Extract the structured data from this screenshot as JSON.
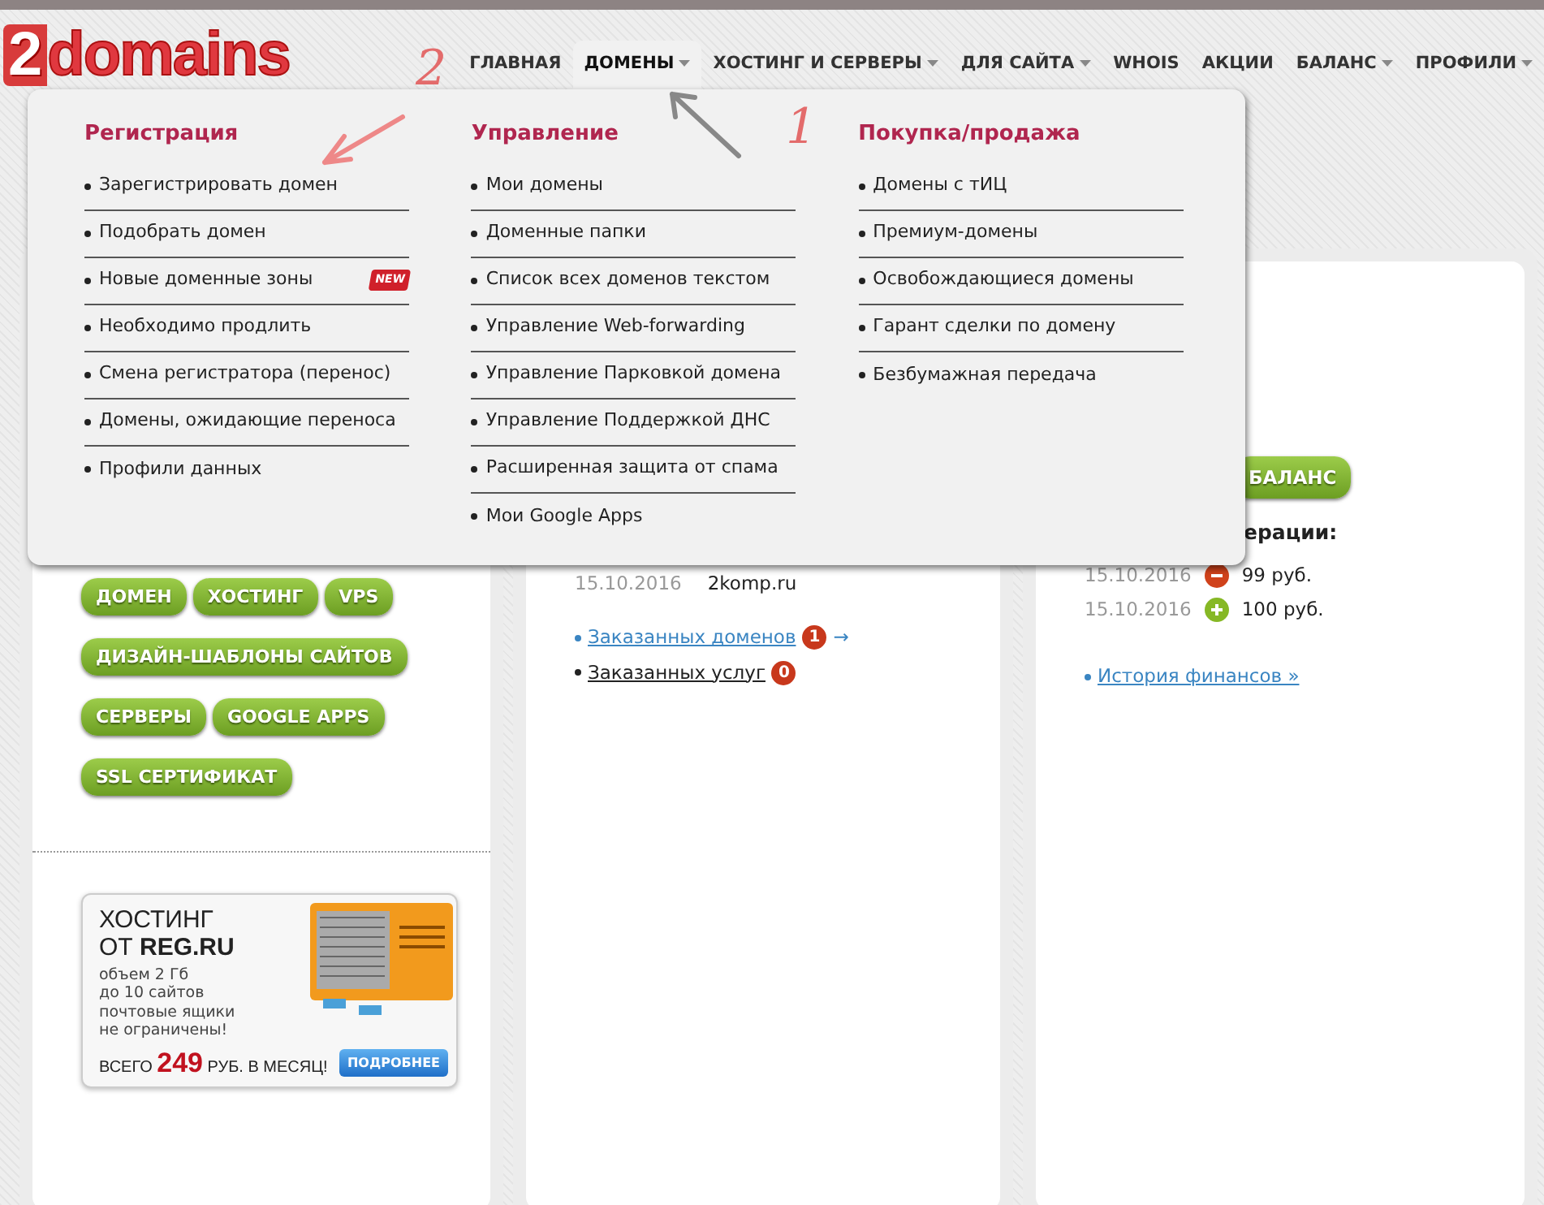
{
  "logo": {
    "digit": "2",
    "word": "domains"
  },
  "nav": [
    {
      "label": "ГЛАВНАЯ",
      "has_menu": false,
      "selected": false
    },
    {
      "label": "ДОМЕНЫ",
      "has_menu": true,
      "selected": true
    },
    {
      "label": "ХОСТИНГ И СЕРВЕРЫ",
      "has_menu": true,
      "selected": false
    },
    {
      "label": "ДЛЯ САЙТА",
      "has_menu": true,
      "selected": false
    },
    {
      "label": "WHOIS",
      "has_menu": false,
      "selected": false
    },
    {
      "label": "АКЦИИ",
      "has_menu": false,
      "selected": false
    },
    {
      "label": "БАЛАНС",
      "has_menu": true,
      "selected": false
    },
    {
      "label": "ПРОФИЛИ",
      "has_menu": true,
      "selected": false
    }
  ],
  "dropdown": {
    "columns": [
      {
        "heading": "Регистрация",
        "items": [
          {
            "label": "Зарегистрировать домен"
          },
          {
            "label": "Подобрать домен"
          },
          {
            "label": "Новые доменные зоны",
            "badge": "NEW"
          },
          {
            "label": "Необходимо продлить"
          },
          {
            "label": "Смена регистратора (перенос)"
          },
          {
            "label": "Домены, ожидающие переноса"
          },
          {
            "label": "Профили данных"
          }
        ]
      },
      {
        "heading": "Управление",
        "items": [
          {
            "label": "Мои домены"
          },
          {
            "label": "Доменные папки"
          },
          {
            "label": "Список всех доменов текстом"
          },
          {
            "label": "Управление Web-forwarding"
          },
          {
            "label": "Управление Парковкой домена"
          },
          {
            "label": "Управление Поддержкой ДНС"
          },
          {
            "label": "Расширенная защита от спама"
          },
          {
            "label": "Мои Google Apps"
          }
        ]
      },
      {
        "heading": "Покупка/продажа",
        "items": [
          {
            "label": "Домены с тИЦ"
          },
          {
            "label": "Премиум-домены"
          },
          {
            "label": "Освобождающиеся домены"
          },
          {
            "label": "Гарант сделки по домену"
          },
          {
            "label": "Безбумажная передача"
          }
        ]
      }
    ]
  },
  "annotations": [
    {
      "label": "2"
    },
    {
      "label": "1"
    }
  ],
  "left_panel": {
    "button_rows": [
      [
        "ДОМЕН",
        "ХОСТИНГ",
        "VPS"
      ],
      [
        "ДИЗАЙН-ШАБЛОНЫ САЙТОВ"
      ],
      [
        "СЕРВЕРЫ",
        "GOOGLE APPS"
      ],
      [
        "SSL СЕРТИФИКАТ"
      ]
    ],
    "banner": {
      "title": "ХОСТИНГ",
      "subtitle": "ОТ **REG.RU**",
      "details": [
        "объем 2 Гб",
        "до 10 сайтов",
        "почтовые ящики",
        "не ограничены!"
      ],
      "price": "ВСЕГО **249** РУБ. В МЕСЯЦ!",
      "button": "ПОДРОБНЕЕ"
    }
  },
  "middle_panel": {
    "recent": [
      {
        "date": "15.10.2016",
        "domain": "2komp.ru"
      }
    ],
    "links": [
      {
        "label": "Заказанных доменов",
        "count": "1",
        "arrow": "→",
        "active": true
      },
      {
        "label": "Заказанных услуг",
        "count": "0",
        "active": false
      }
    ]
  },
  "right_panel": {
    "balance_button": "БАЛАНС",
    "operations_heading": "ерации:",
    "operations": [
      {
        "date": "15.10.2016",
        "kind": "minus",
        "amount": "99 руб."
      },
      {
        "date": "15.10.2016",
        "kind": "plus",
        "amount": "100 руб."
      }
    ],
    "history_link": "История финансов »"
  }
}
